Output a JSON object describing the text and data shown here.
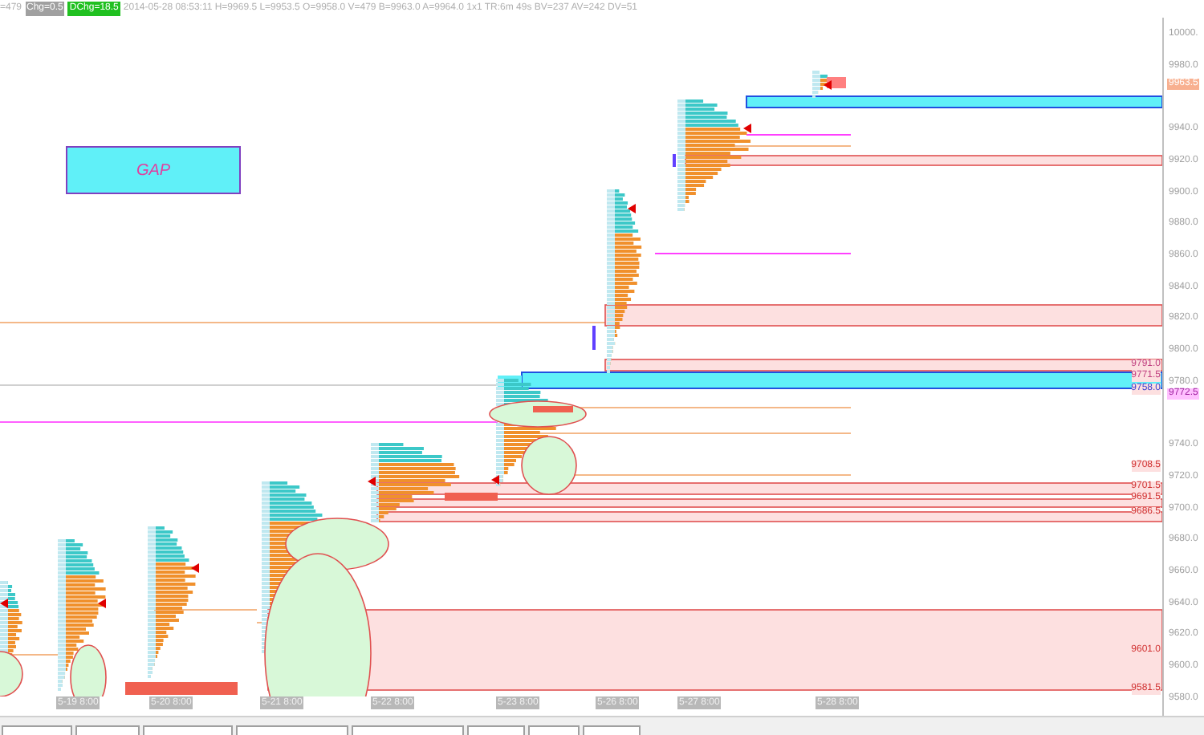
{
  "status_line": {
    "volume": "=479",
    "change": "Chg=0.5",
    "day_change": "DChg=18.5",
    "details": "2014-05-28 08:53:11 H=9969.5 L=9953.5 O=9958.0 V=479 B=9963.0 A=9964.0 1x1 TR:6m 49s BV=237 AV=242 DV=51"
  },
  "annotation": {
    "text": "GAP"
  },
  "price_axis": {
    "ticks": [
      "10000.",
      "9980.0",
      "9940.0",
      "9920.0",
      "9900.0",
      "9880.0",
      "9860.0",
      "9840.0",
      "9820.0",
      "9800.0",
      "9780.0",
      "9740.0",
      "9720.0",
      "9700.0",
      "9680.0",
      "9660.0",
      "9640.0",
      "9620.0",
      "9600.0",
      "9580.0"
    ],
    "last_price": "9963.5",
    "marker": "9772.5"
  },
  "level_labels": [
    {
      "text": "9791.0",
      "color": "#c04080"
    },
    {
      "text": "9771.5",
      "color": "#c04080"
    },
    {
      "text": "9758.0",
      "color": "#4040d0"
    },
    {
      "text": "9708.5",
      "color": "#d03030"
    },
    {
      "text": "9701.5",
      "color": "#d03030"
    },
    {
      "text": "9691.5",
      "color": "#d03030"
    },
    {
      "text": "9686.5",
      "color": "#d03030"
    },
    {
      "text": "9601.0",
      "color": "#d03030"
    },
    {
      "text": "9581.5",
      "color": "#d03030"
    }
  ],
  "date_labels": [
    "5-19 8:00",
    "5-20 8:00",
    "5-21 8:00",
    "5-22 8:00",
    "5-23 8:00",
    "5-26 8:00",
    "5-27 8:00",
    "5-28 8:00"
  ]
}
